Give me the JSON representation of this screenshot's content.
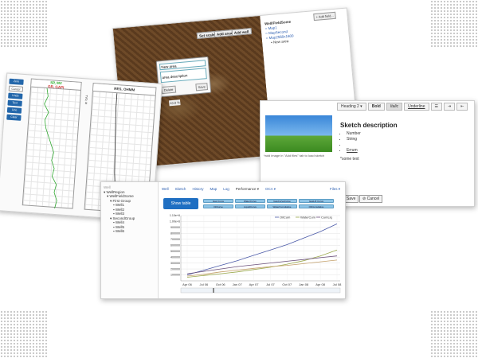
{
  "map_window": {
    "buttons": [
      "Set scale",
      "Add area",
      "Add well"
    ],
    "popup": {
      "title_value": "New area",
      "desc_value": "area description",
      "delete_label": "Delete",
      "save_label": "Save",
      "scale_text": "43.8 %"
    },
    "tree": {
      "header": "Well/FieldSome",
      "add_field": "+ Add field...",
      "items": [
        {
          "label": "Map1",
          "link": true
        },
        {
          "label": "MapSecond",
          "link": true
        },
        {
          "label": "Map2560x1600",
          "link": true
        },
        {
          "label": "New area",
          "link": false
        }
      ]
    }
  },
  "sketch_editor": {
    "toolbar": [
      "Heading 2 ▾",
      "Bold",
      "Italic",
      "Underline"
    ],
    "image_caption": "*add image in \"Add files\" tab to load sketch",
    "title": "Sketch description",
    "list": [
      "Number",
      "String",
      "",
      "Errum"
    ],
    "footnote": "*some text",
    "save_label": "Save",
    "cancel_label": "Cancel"
  },
  "well_log": {
    "side_buttons": [
      "Zero",
      "Cancel",
      "Undo",
      "Text",
      "Line",
      "Clear"
    ],
    "tracks": [
      {
        "header": [
          "SP, MV",
          "GR, GAPI"
        ]
      },
      {
        "header": [
          "RES, OHMM"
        ]
      }
    ],
    "depth_label": "TVD, M",
    "depths": [
      "200",
      "400",
      "600"
    ]
  },
  "main_window": {
    "tree": {
      "search": "Well",
      "items": [
        "WellRegion",
        "WellFieldSome",
        "First Group",
        "Well1",
        "Well2",
        "Well3",
        "SecondGroup",
        "Well4",
        "Well5",
        "Well6"
      ]
    },
    "nav_tabs": [
      "Well",
      "Sketch",
      "History",
      "Map",
      "Log",
      "Performance ▾",
      "OCA ▾"
    ],
    "files_label": "Files ▾",
    "show_table_label": "Show table",
    "pills": [
      "Gas Curve",
      "WaterCurve",
      "GasCurveCurve",
      "GasLift Curve",
      "OilCurve",
      "LiquidCurve",
      "WaterCumulative",
      "OilCumulative",
      "LiqCurve",
      "CumLiq"
    ],
    "legend": [
      "OilCum",
      "WaterCum",
      "CumLiq"
    ]
  },
  "chart_data": {
    "type": "line",
    "x": [
      "Apr 06",
      "Jul 06",
      "Oct 06",
      "Jan 07",
      "Apr 07",
      "Jul 07",
      "Oct 07",
      "Jan 08",
      "Apr 08",
      "Jul 08"
    ],
    "yticks": [
      "100000",
      "200000",
      "300000",
      "400000",
      "500000",
      "600000",
      "700000",
      "800000",
      "900000",
      "1.00e+6",
      "1.10e+6"
    ],
    "ylim": [
      0,
      1100000
    ],
    "series": [
      {
        "name": "OilCum",
        "color": "#4b5aa8",
        "values": [
          100000,
          180000,
          260000,
          340000,
          430000,
          520000,
          610000,
          720000,
          830000,
          960000
        ]
      },
      {
        "name": "WaterCum",
        "color": "#9aa84b",
        "values": [
          60000,
          90000,
          120000,
          150000,
          190000,
          230000,
          280000,
          340000,
          420000,
          520000
        ]
      },
      {
        "name": "CumLiq",
        "color": "#6a4f7a",
        "values": [
          120000,
          160000,
          200000,
          240000,
          270000,
          300000,
          330000,
          360000,
          390000,
          420000
        ]
      },
      {
        "name": "",
        "color": "#c4a06a",
        "values": [
          80000,
          110000,
          150000,
          180000,
          210000,
          240000,
          260000,
          290000,
          320000,
          350000
        ]
      }
    ]
  }
}
